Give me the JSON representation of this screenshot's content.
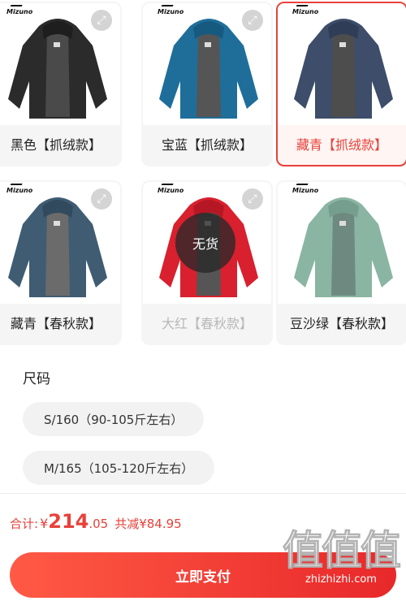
{
  "variants": [
    {
      "label": "黑色【抓绒款】",
      "state": "normal",
      "zoom_icon": "zoom-icon",
      "jacket_color": "#2b2b2b",
      "lining_color": "#4a4a4a"
    },
    {
      "label": "宝蓝【抓绒款】",
      "state": "normal",
      "zoom_icon": "zoom-icon",
      "jacket_color": "#1f6e9a",
      "lining_color": "#555555"
    },
    {
      "label": "藏青【抓绒款】",
      "state": "selected",
      "jacket_color": "#3d4d6a",
      "lining_color": "#4d4d4d"
    },
    {
      "label": "藏青【春秋款】",
      "state": "normal",
      "zoom_icon": "zoom-icon",
      "jacket_color": "#3f5c72",
      "lining_color": "#6b6b6b"
    },
    {
      "label": "大红【春秋款】",
      "state": "disabled",
      "zoom_icon": "zoom-icon",
      "badge": "无货",
      "jacket_color": "#d8202e",
      "lining_color": "#555555"
    },
    {
      "label": "豆沙绿【春秋款】",
      "state": "normal",
      "jacket_color": "#8ab5a3",
      "lining_color": "#6e8a80"
    }
  ],
  "brand_text": "Mizuno",
  "size_section": {
    "title": "尺码",
    "options": [
      "S/160（90-105斤左右）",
      "M/165（105-120斤左右）"
    ]
  },
  "summary": {
    "total_label": "合计:",
    "currency": "¥",
    "price_int": "214",
    "price_dec": ".05",
    "saved_text": "共减¥84.95"
  },
  "pay_button": {
    "label": "立即支付"
  },
  "watermark": {
    "big": "值值值",
    "small": "zhizhizhi.com"
  },
  "colors": {
    "accent": "#e8413a",
    "pill_bg": "#f2f2f2",
    "card_bg": "#f5f5f5"
  }
}
